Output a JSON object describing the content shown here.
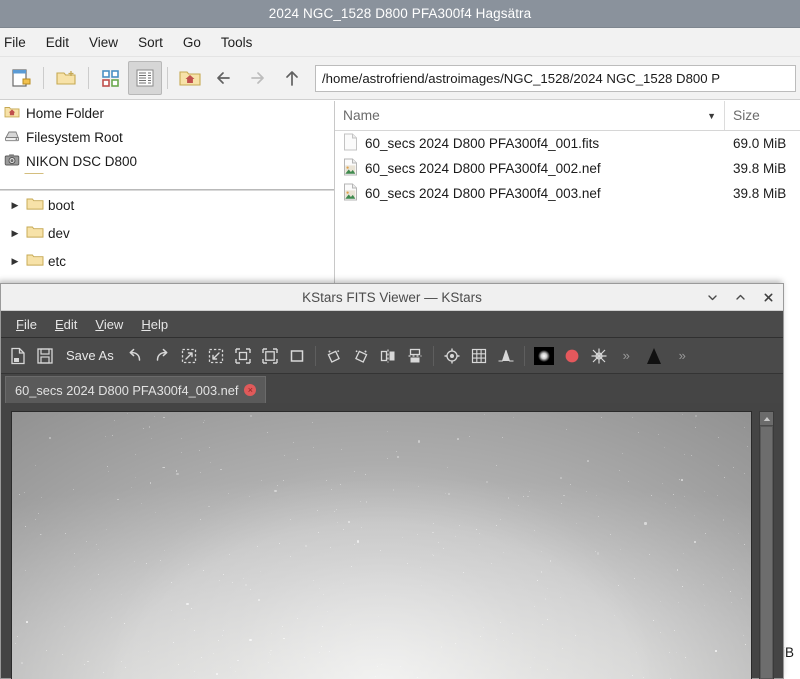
{
  "file_manager": {
    "title": "2024 NGC_1528 D800 PFA300f4 Hagsätra",
    "menu": [
      "File",
      "Edit",
      "View",
      "Sort",
      "Go",
      "Tools"
    ],
    "toolbar": {
      "new_tab": "new-tab",
      "new_folder": "new-folder",
      "icon_view": "icon-view",
      "list_view": "list-view",
      "home": "home",
      "back": "back",
      "forward": "forward",
      "up": "up"
    },
    "path": "/home/astrofriend/astroimages/NGC_1528/2024 NGC_1528 D800 P",
    "places": [
      {
        "label": "Home Folder",
        "icon": "home-folder-icon"
      },
      {
        "label": "Filesystem Root",
        "icon": "drive-icon"
      },
      {
        "label": "NIKON DSC D800",
        "icon": "camera-icon"
      }
    ],
    "tree": [
      {
        "label": "boot",
        "icon": "folder-icon",
        "expander": "▶"
      },
      {
        "label": "dev",
        "icon": "folder-icon",
        "expander": "▶"
      },
      {
        "label": "etc",
        "icon": "folder-icon",
        "expander": "▶"
      }
    ],
    "columns": {
      "name": "Name",
      "size": "Size",
      "sort_caret": "▼"
    },
    "files": [
      {
        "name": "60_secs 2024 D800 PFA300f4_001.fits",
        "size": "69.0 MiB",
        "icon": "generic-file-icon"
      },
      {
        "name": "60_secs 2024 D800 PFA300f4_002.nef",
        "size": "39.8 MiB",
        "icon": "image-file-icon"
      },
      {
        "name": "60_secs 2024 D800 PFA300f4_003.nef",
        "size": "39.8 MiB",
        "icon": "image-file-icon"
      }
    ],
    "peek_size_fragment": "iB"
  },
  "fits_viewer": {
    "title": "KStars FITS Viewer — KStars",
    "window_buttons": {
      "minimize": "⌄",
      "maximize": "⌃",
      "close": "✕"
    },
    "menu": [
      {
        "label": "File",
        "accel": "F",
        "rest": "ile"
      },
      {
        "label": "Edit",
        "accel": "E",
        "rest": "dit"
      },
      {
        "label": "View",
        "accel": "V",
        "rest": "iew"
      },
      {
        "label": "Help",
        "accel": "H",
        "rest": "elp"
      }
    ],
    "toolbar": [
      {
        "name": "open-file-button",
        "kind": "icon",
        "icon": "open-file-icon"
      },
      {
        "name": "save-button",
        "kind": "icon",
        "icon": "save-icon"
      },
      {
        "name": "save-as-button",
        "kind": "text",
        "label": "Save As"
      },
      {
        "name": "undo-button",
        "kind": "icon",
        "icon": "undo-icon"
      },
      {
        "name": "redo-button",
        "kind": "icon",
        "icon": "redo-icon"
      },
      {
        "name": "zoom-in-button",
        "kind": "icon",
        "icon": "zoom-in-icon"
      },
      {
        "name": "zoom-out-button",
        "kind": "icon",
        "icon": "zoom-out-icon"
      },
      {
        "name": "zoom-default-button",
        "kind": "icon",
        "icon": "zoom-default-icon"
      },
      {
        "name": "zoom-fit-button",
        "kind": "icon",
        "icon": "zoom-fit-icon"
      },
      {
        "name": "zoom-actual-button",
        "kind": "icon",
        "icon": "zoom-actual-icon"
      },
      {
        "name": "rotate-ccw-button",
        "kind": "icon",
        "icon": "rotate-ccw-icon"
      },
      {
        "name": "rotate-cw-button",
        "kind": "icon",
        "icon": "rotate-cw-icon"
      },
      {
        "name": "flip-horizontal-button",
        "kind": "icon",
        "icon": "flip-horizontal-icon"
      },
      {
        "name": "flip-vertical-button",
        "kind": "icon",
        "icon": "flip-vertical-icon"
      },
      {
        "name": "crosshair-button",
        "kind": "icon",
        "icon": "crosshair-icon"
      },
      {
        "name": "grid-button",
        "kind": "icon",
        "icon": "grid-icon"
      },
      {
        "name": "histogram-button",
        "kind": "icon",
        "icon": "histogram-icon"
      },
      {
        "name": "star-profile-button",
        "kind": "icon",
        "icon": "star-profile-icon"
      },
      {
        "name": "mark-stars-button",
        "kind": "icon",
        "icon": "red-dot-icon"
      },
      {
        "name": "detect-stars-button",
        "kind": "icon",
        "icon": "star-detect-icon"
      }
    ],
    "toolbar_overflow": "»",
    "toolbar_extra_icon": "mountain-icon",
    "tab": {
      "label": "60_secs 2024 D800 PFA300f4_003.nef",
      "close": "×"
    },
    "scrollbar": {
      "up_arrow": "▲"
    }
  },
  "colors": {
    "fm_titlebar": "#8a929c",
    "fm_chrome": "#f2f2f2",
    "kv_chrome": "#4a4a4a",
    "kv_titlebar": "#f0f0f0",
    "tab_close_red": "#e05a5a",
    "folder_yellow": "#f5deа0"
  }
}
